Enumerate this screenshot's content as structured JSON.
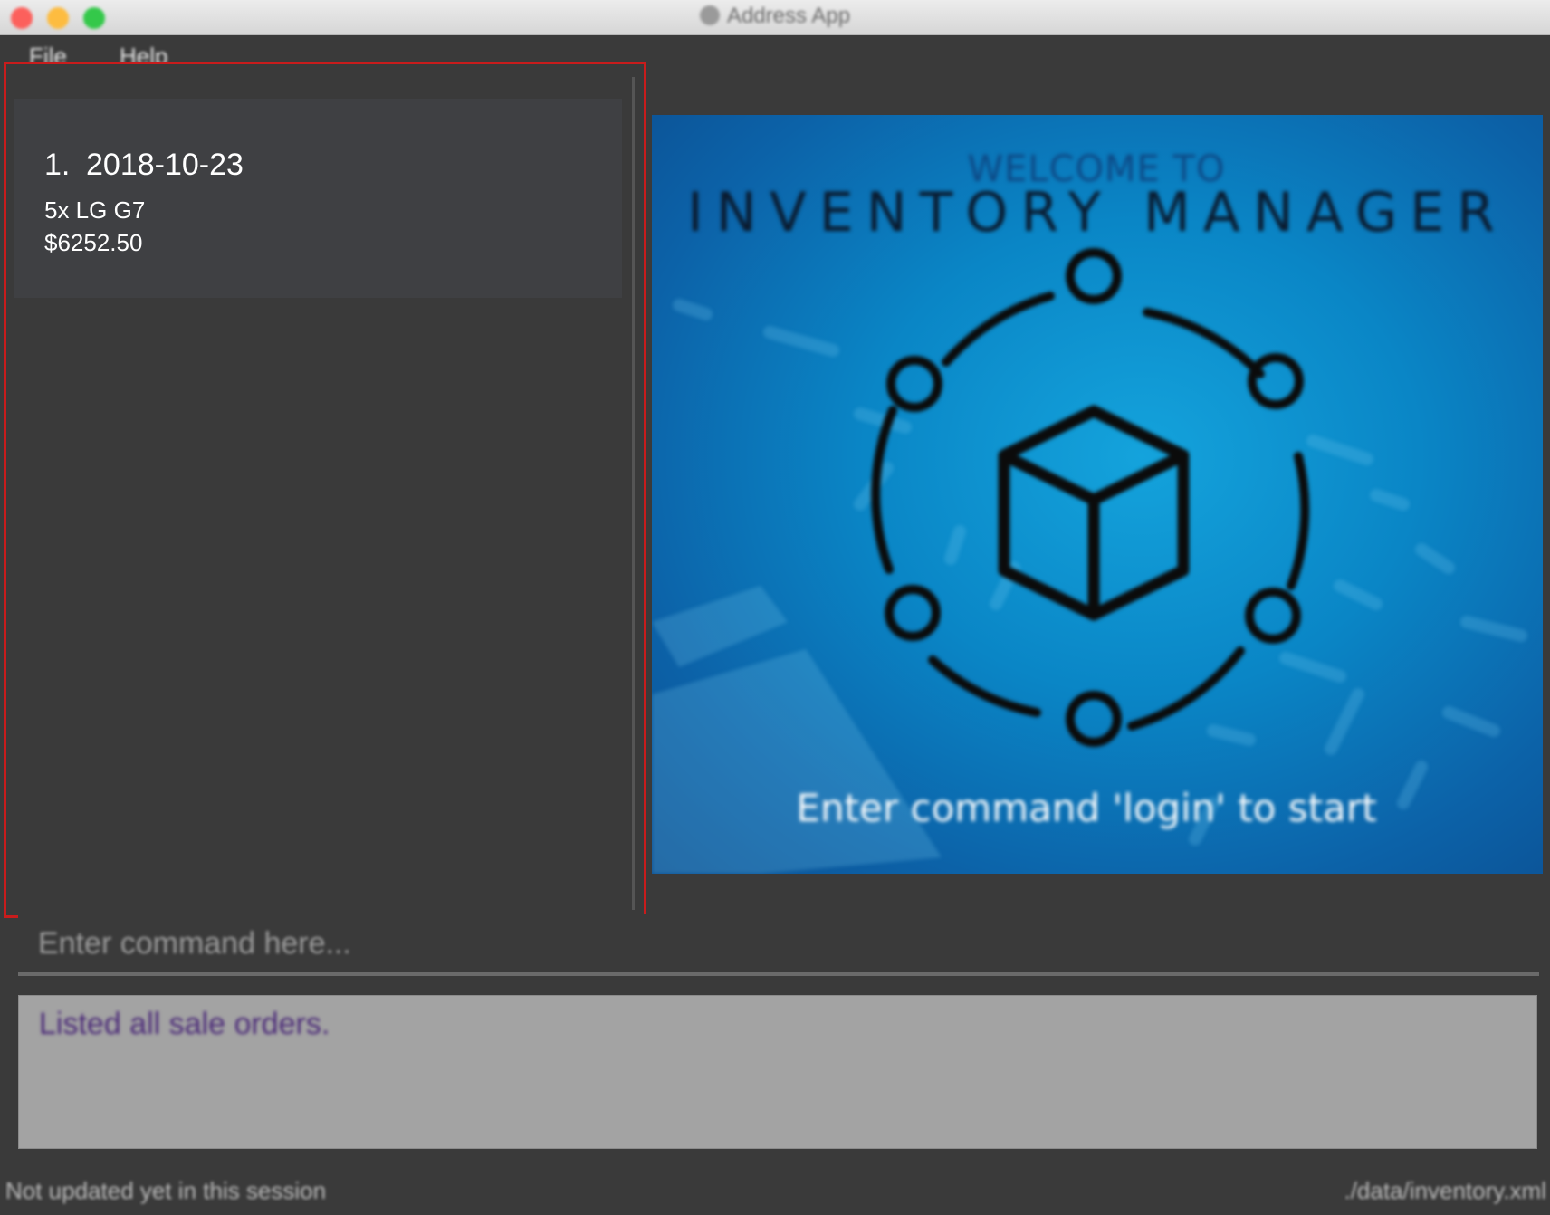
{
  "window": {
    "title": "Address App"
  },
  "menubar": {
    "items": [
      {
        "label": "File"
      },
      {
        "label": "Help"
      }
    ]
  },
  "sale_orders": [
    {
      "index": "1.",
      "date": "2018-10-23",
      "items": "5x LG G7",
      "total": "$6252.50"
    }
  ],
  "welcome": {
    "subtitle": "WELCOME TO",
    "title": "INVENTORY MANAGER",
    "hint": "Enter command 'login' to start",
    "logo": "inventory-cube-network-icon"
  },
  "command_box": {
    "placeholder": "Enter command here...",
    "value": ""
  },
  "result_display": {
    "text": "Listed all sale orders."
  },
  "statusbar": {
    "sync_status": "Not updated yet in this session",
    "save_location": "./data/inventory.xml"
  },
  "colors": {
    "selection_border": "#c81c1c",
    "result_text": "#4b2a78",
    "background": "#3a3a3a",
    "welcome_blue": "#0a86c6"
  }
}
